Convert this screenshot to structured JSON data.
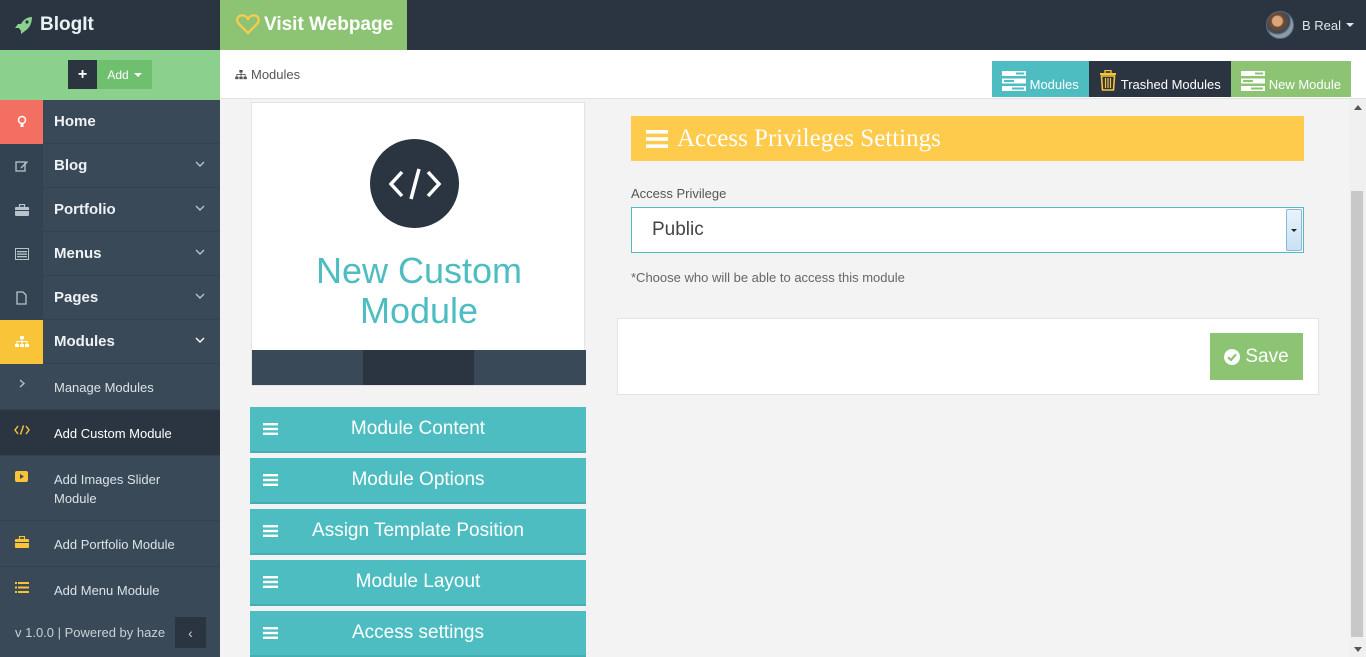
{
  "topbar": {
    "brand": "BlogIt",
    "visit_label": "Visit Webpage",
    "user_name": "B Real"
  },
  "sidebar": {
    "add_plus": "+",
    "add_label": "Add",
    "items": [
      {
        "label": "Home",
        "icon": "lightbulb-icon"
      },
      {
        "label": "Blog",
        "icon": "edit-icon"
      },
      {
        "label": "Portfolio",
        "icon": "briefcase-icon"
      },
      {
        "label": "Menus",
        "icon": "list-alt-icon"
      },
      {
        "label": "Pages",
        "icon": "file-icon"
      },
      {
        "label": "Modules",
        "icon": "sitemap-icon"
      }
    ],
    "subitems": [
      {
        "label": "Manage Modules",
        "icon": "chevron-right-icon"
      },
      {
        "label": "Add Custom Module",
        "icon": "code-icon"
      },
      {
        "label": "Add Images Slider Module",
        "icon": "play-icon"
      },
      {
        "label": "Add Portfolio Module",
        "icon": "briefcase-icon"
      },
      {
        "label": "Add Menu Module",
        "icon": "list-icon"
      }
    ],
    "footer": "v 1.0.0 | Powered by haze",
    "collapse_label": "‹"
  },
  "breadcrumb": {
    "label": "Modules"
  },
  "actions": {
    "modules": "Modules",
    "trashed": "Trashed Modules",
    "new_module": "New Module"
  },
  "card": {
    "title": "New Custom Module",
    "icon": "code-icon"
  },
  "module_menu": [
    "Module Content",
    "Module Options",
    "Assign Template Position",
    "Module Layout",
    "Access settings"
  ],
  "panel": {
    "title": "Access Privileges Settings",
    "field_label": "Access Privilege",
    "selected": "Public",
    "hint": "*Choose who will be able to access this module",
    "save_label": "Save"
  },
  "colors": {
    "teal": "#4ebdc2",
    "dark": "#2b3541",
    "green": "#8cc474",
    "yellow": "#ffcb4c",
    "red": "#f36f62",
    "sidebar": "#3a4958"
  }
}
